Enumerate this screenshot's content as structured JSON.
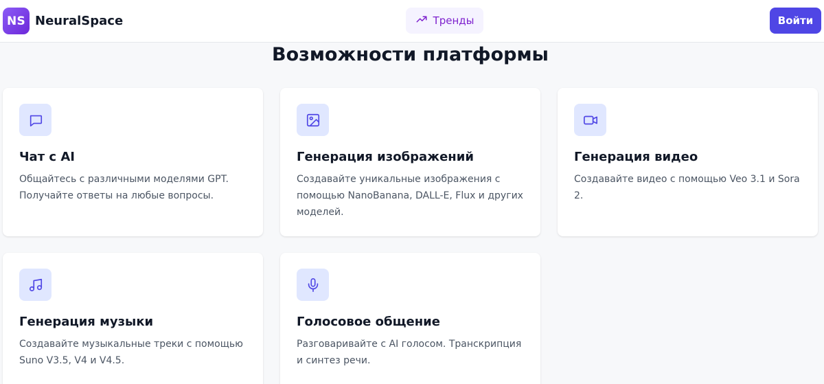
{
  "header": {
    "logo_badge": "NS",
    "logo_name": "NeuralSpace",
    "trends_label": "Тренды",
    "login_label": "Войти"
  },
  "section": {
    "title": "Возможности платформы"
  },
  "cards": [
    {
      "icon": "chat-icon",
      "title": "Чат с AI",
      "description": "Общайтесь с различными моделями GPT. Получайте ответы на любые вопросы."
    },
    {
      "icon": "image-icon",
      "title": "Генерация изображений",
      "description": "Создавайте уникальные изображения с помощью NanoBanana, DALL-E, Flux и других моделей."
    },
    {
      "icon": "video-icon",
      "title": "Генерация видео",
      "description": "Создавайте видео с помощью Veo 3.1 и Sora 2."
    },
    {
      "icon": "music-icon",
      "title": "Генерация музыки",
      "description": "Создавайте музыкальные треки с помощью Suno V3.5, V4 и V4.5."
    },
    {
      "icon": "microphone-icon",
      "title": "Голосовое общение",
      "description": "Разговаривайте с AI голосом. Транскрипция и синтез речи."
    }
  ],
  "colors": {
    "accent": "#4f46e5",
    "icon_bg": "#e0e7ff",
    "trends_text": "#7e22ce"
  }
}
